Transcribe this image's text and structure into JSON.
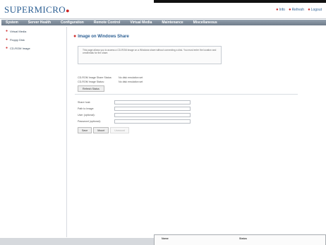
{
  "header": {
    "logo": "SUPERMICRO",
    "links": [
      {
        "label": "Info",
        "icon": "info-icon"
      },
      {
        "label": "Refresh",
        "icon": "refresh-icon"
      },
      {
        "label": "Logout",
        "icon": "logout-icon"
      }
    ]
  },
  "menu": {
    "items": [
      "System",
      "Server Health",
      "Configuration",
      "Remote Control",
      "Virtual Media",
      "Maintenance",
      "Miscellaneous"
    ]
  },
  "sidebar": {
    "items": [
      {
        "label": "Virtual Media",
        "icon": "arrow-icon"
      },
      {
        "label": "Floppy Disk",
        "icon": "arrow-icon"
      },
      {
        "label": "CD-ROM Image",
        "icon": "arrow-icon"
      }
    ]
  },
  "main": {
    "title": "Image on Windows Share",
    "info_text": "This page allows you to access a CD-ROM image on a Windows share without connecting a disk. You must enter the location and credentials for the share.",
    "status": [
      {
        "label": "CD-ROM Image Share Status:",
        "value": "No disk emulation set"
      },
      {
        "label": "CD-ROM Image Status:",
        "value": "No disk emulation set"
      }
    ],
    "refresh_button": "Refresh Status",
    "form": {
      "fields": [
        {
          "label": "Share host:",
          "value": ""
        },
        {
          "label": "Path to Image:",
          "value": ""
        },
        {
          "label": "User (optional):",
          "value": ""
        },
        {
          "label": "Password (optional):",
          "value": ""
        }
      ],
      "buttons": {
        "save": "Save",
        "mount": "Mount",
        "unmount": "Unmount"
      }
    }
  },
  "bottom_panel": {
    "col1": "Name",
    "col2": "Status"
  }
}
